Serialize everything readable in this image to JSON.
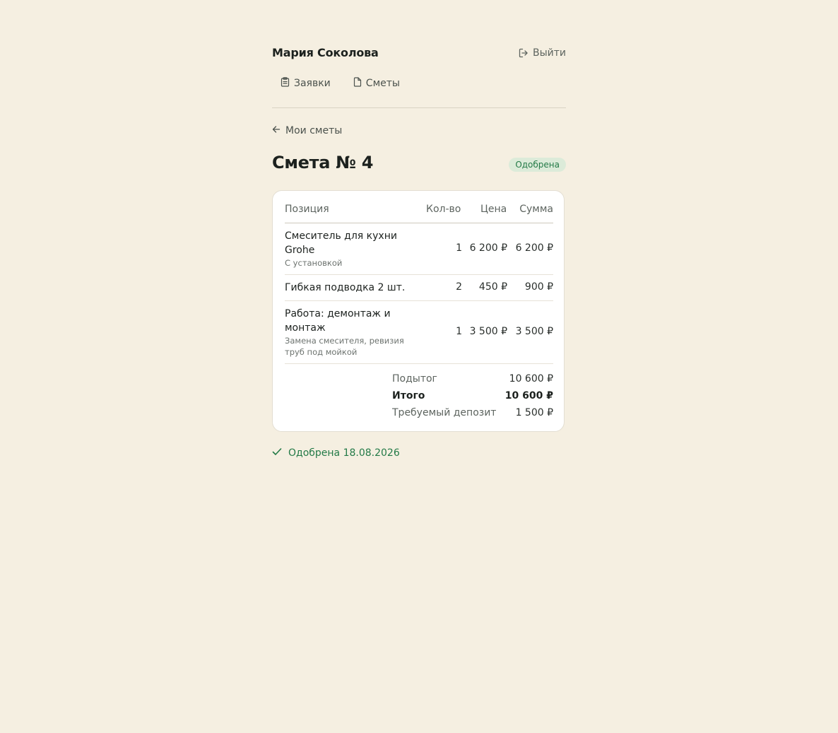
{
  "header": {
    "user_name": "Мария Соколова",
    "logout_label": "Выйти"
  },
  "nav": {
    "requests_label": "Заявки",
    "estimates_label": "Сметы"
  },
  "back_link": {
    "label": "Мои сметы"
  },
  "page": {
    "title": "Смета № 4",
    "status": "Одобрена"
  },
  "table": {
    "columns": {
      "item": "Позиция",
      "qty": "Кол-во",
      "price": "Цена",
      "sum": "Сумма"
    },
    "rows": [
      {
        "name": "Смеситель для кухни Grohe",
        "note": "С установкой",
        "qty": "1",
        "price": "6 200 ₽",
        "sum": "6 200 ₽"
      },
      {
        "name": "Гибкая подводка 2 шт.",
        "note": "",
        "qty": "2",
        "price": "450 ₽",
        "sum": "900 ₽"
      },
      {
        "name": "Работа: демонтаж и монтаж",
        "note": "Замена смесителя, ревизия труб под мойкой",
        "qty": "1",
        "price": "3 500 ₽",
        "sum": "3 500 ₽"
      }
    ]
  },
  "totals": {
    "subtotal_label": "Подытог",
    "subtotal_value": "10 600 ₽",
    "total_label": "Итого",
    "total_value": "10 600 ₽",
    "deposit_label": "Требуемый депозит",
    "deposit_value": "1 500 ₽"
  },
  "approval": {
    "text": "Одобрена 18.08.2026"
  },
  "colors": {
    "background": "#f5efe1",
    "accent_green": "#237a47",
    "badge_bg": "#dcebd9"
  }
}
